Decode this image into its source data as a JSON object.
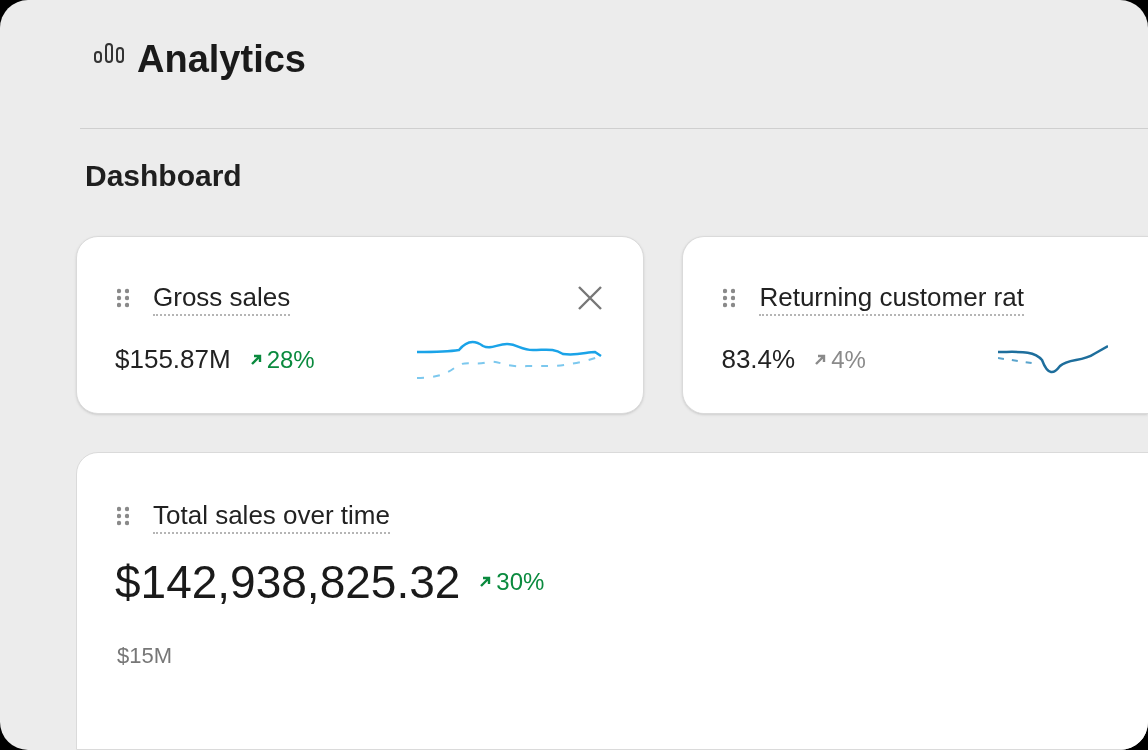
{
  "header": {
    "title": "Analytics"
  },
  "section": {
    "title": "Dashboard"
  },
  "metric_cards": [
    {
      "title": "Gross sales",
      "value": "$155.87M",
      "change": "28%",
      "color": "#0a8a3e",
      "closable": true
    },
    {
      "title": "Returning customer rat",
      "value": "83.4%",
      "change": "4%",
      "color": "#8a8a8a",
      "closable": false
    }
  ],
  "sales_card": {
    "title": "Total sales over time",
    "value": "$142,938,825.32",
    "change": "30%",
    "color": "#0a8a3e",
    "axis_label": "$15M"
  }
}
